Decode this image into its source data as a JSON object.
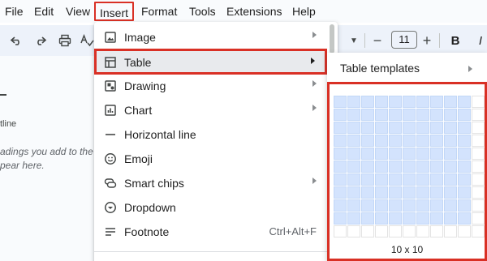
{
  "menubar": {
    "items": [
      "File",
      "Edit",
      "View",
      "Insert",
      "Format",
      "Tools",
      "Extensions",
      "Help"
    ],
    "active": "Insert"
  },
  "toolbar": {
    "font_size": "11",
    "minus": "−",
    "plus": "+",
    "bold": "B",
    "italic": "I"
  },
  "outline": {
    "label": "tline",
    "hint_line1": "adings you add to the",
    "hint_line2": "pear here."
  },
  "insert_menu": {
    "items": [
      {
        "label": "Image",
        "icon": "image-icon",
        "submenu": true
      },
      {
        "label": "Table",
        "icon": "table-icon",
        "submenu": true
      },
      {
        "label": "Drawing",
        "icon": "drawing-icon",
        "submenu": true
      },
      {
        "label": "Chart",
        "icon": "chart-icon",
        "submenu": true
      },
      {
        "label": "Horizontal line",
        "icon": "horizontal-line-icon",
        "submenu": false
      },
      {
        "label": "Emoji",
        "icon": "emoji-icon",
        "submenu": false
      },
      {
        "label": "Smart chips",
        "icon": "smart-chips-icon",
        "submenu": true
      },
      {
        "label": "Dropdown",
        "icon": "dropdown-icon",
        "submenu": false
      },
      {
        "label": "Footnote",
        "icon": "footnote-icon",
        "submenu": false,
        "shortcut": "Ctrl+Alt+F"
      }
    ],
    "highlighted": "Table"
  },
  "table_submenu": {
    "templates_label": "Table templates",
    "grid": {
      "rows": 10,
      "cols": 10,
      "selected_rows": 10,
      "selected_cols": 10
    },
    "size_label": "10 x 10"
  },
  "colors": {
    "highlight_border": "#d93025",
    "selected_cell": "#d3e3fd",
    "toolbar_bg": "#edf2fa"
  }
}
